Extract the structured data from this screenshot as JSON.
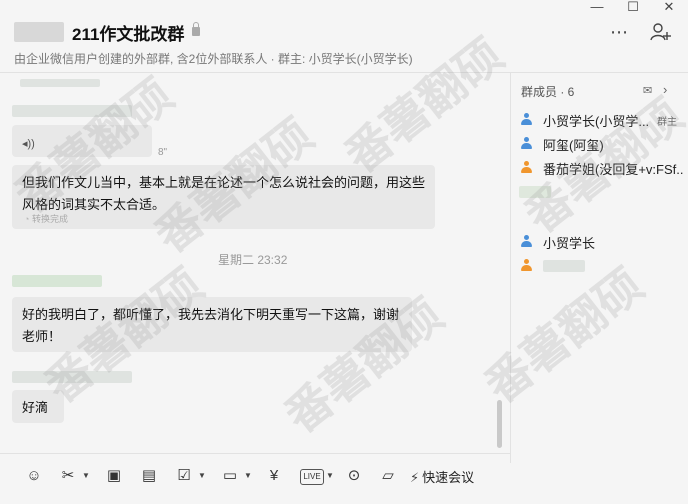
{
  "header": {
    "title": "211作文批改群",
    "subtitle": "由企业微信用户创建的外部群, 含2位外部联系人 · 群主: 小贸学长(小贸学长)",
    "window_controls": [
      "—",
      "☐",
      "✕"
    ],
    "more_icon": "⋯",
    "add_member_icon": "person-add-icon"
  },
  "chat": {
    "messages": [
      {
        "text": "但我们作文儿当中，基本上就是在论述一个怎么说社会的问题，用这些风格的词其实不太合适。",
        "status": "转换完成"
      },
      {
        "time": "星期二 23:32"
      },
      {
        "text": "好的我明白了，都听懂了，我先去消化下明天重写一下这篇，谢谢老师！"
      },
      {
        "text": "好滴"
      }
    ],
    "voice_duration": "8\""
  },
  "members": {
    "title": "群成员 · 6",
    "owner_tag": "群主",
    "list": [
      {
        "name": "小贸学长(小贸学...",
        "role": "owner",
        "color": "#4a8fd8"
      },
      {
        "name": "阿玺(阿玺)",
        "color": "#4a8fd8"
      },
      {
        "name": "番茄学姐(没回复+v:FSf...",
        "color": "#f0962e"
      },
      {
        "name": "",
        "color": "#cccccc"
      },
      {
        "name": "小贸学长",
        "color": "#4a8fd8"
      },
      {
        "name": "",
        "color": "#f0962e"
      }
    ]
  },
  "toolbar": {
    "meeting_label": "快速会议",
    "icons": [
      "emoji-icon",
      "scissors-icon",
      "image-icon",
      "document-icon",
      "todo-icon",
      "folder-icon",
      "red-envelope-icon",
      "live-icon",
      "more-icon"
    ]
  },
  "watermark": "番薯翻硕"
}
